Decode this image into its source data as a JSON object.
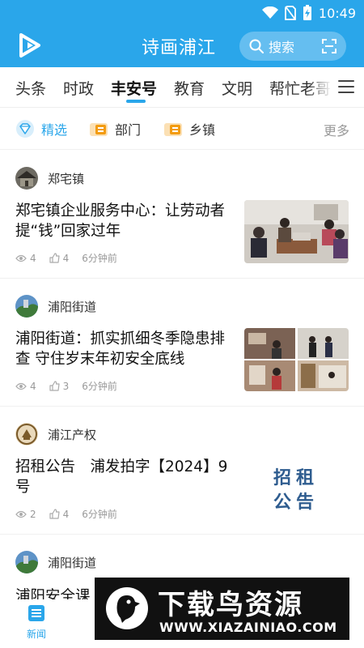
{
  "status_bar": {
    "time": "10:49"
  },
  "header": {
    "title": "诗画浦江",
    "search_label": "搜索"
  },
  "tabs": [
    {
      "label": "头条"
    },
    {
      "label": "时政"
    },
    {
      "label": "丰安号",
      "active": true
    },
    {
      "label": "教育"
    },
    {
      "label": "文明"
    },
    {
      "label": "帮忙老哥"
    }
  ],
  "subnav": {
    "items": [
      {
        "label": "精选",
        "icon": "diamond-icon",
        "active": true
      },
      {
        "label": "部门",
        "icon": "department-icon"
      },
      {
        "label": "乡镇",
        "icon": "township-icon"
      }
    ],
    "more_label": "更多"
  },
  "feed": [
    {
      "author": "郑宅镇",
      "headline": "郑宅镇企业服务中心：让劳动者提“钱”回家过年",
      "views": "4",
      "likes": "4",
      "time": "6分钟前",
      "thumb": "meeting-photo"
    },
    {
      "author": "浦阳街道",
      "headline": "浦阳街道：抓实抓细冬季隐患排查 守住岁末年初安全底线",
      "views": "4",
      "likes": "3",
      "time": "6分钟前",
      "thumb": "inspection-collage"
    },
    {
      "author": "浦江产权",
      "headline": "招租公告　浦发拍字【2024】9号",
      "views": "2",
      "likes": "4",
      "time": "6分钟前",
      "thumb": "notice-image",
      "thumb_text": "招租\n公告"
    },
    {
      "author": "浦阳街道",
      "headline_partial": "浦阳安全课"
    }
  ],
  "bottom_nav": {
    "items": [
      {
        "label": "新闻",
        "active": true
      }
    ]
  },
  "watermark": {
    "title": "下载鸟资源",
    "url": "WWW.XIAZAINIAO.COM"
  },
  "colors": {
    "primary": "#2aa6ea",
    "header_bg": "#2aa6ea"
  }
}
